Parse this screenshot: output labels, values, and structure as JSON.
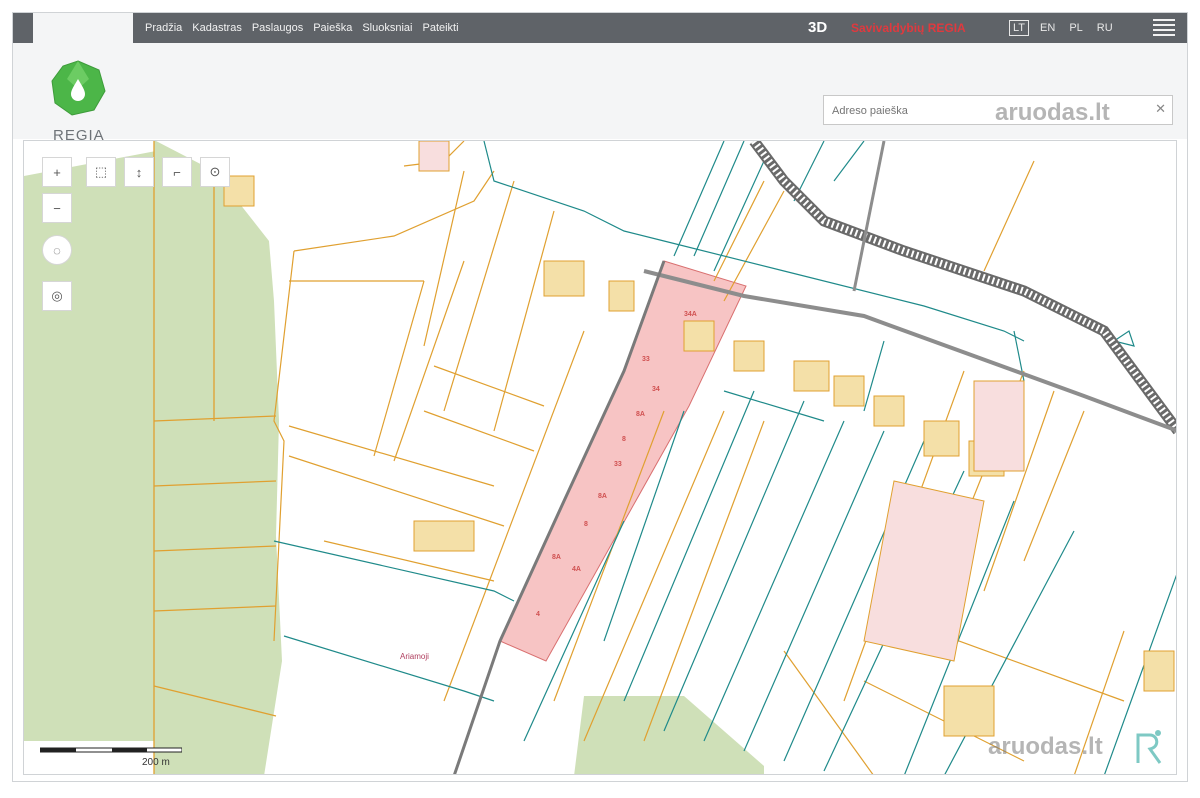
{
  "app": {
    "name": "REGIA",
    "brand": "Savivaldybių REGIA",
    "mode_3d": "3D"
  },
  "menu": {
    "items": [
      {
        "label": "Pradžia"
      },
      {
        "label": "Kadastras"
      },
      {
        "label": "Paslaugos"
      },
      {
        "label": "Paieška"
      },
      {
        "label": "Sluoksniai"
      },
      {
        "label": "Pateikti"
      }
    ]
  },
  "languages": [
    {
      "code": "LT",
      "active": true
    },
    {
      "code": "EN",
      "active": false
    },
    {
      "code": "PL",
      "active": false
    },
    {
      "code": "RU",
      "active": false
    }
  ],
  "search": {
    "placeholder": "Adreso paieška"
  },
  "watermark": {
    "text": "aruodas.lt"
  },
  "map": {
    "scale_label": "200 m",
    "parcel_labels": [
      "34A",
      "33",
      "34",
      "8A",
      "8",
      "33",
      "8A",
      "8",
      "8A",
      "4A",
      "4"
    ],
    "area_label": "Ariamoji",
    "highlight_color": "#f7c4c4",
    "parcel_orange": "#e0a030",
    "parcel_teal": "#1f8a8a",
    "forest_green": "#cfe0b8"
  },
  "tools": [
    {
      "icon": "zoom-in-icon",
      "glyph": "+"
    },
    {
      "icon": "zoom-out-icon",
      "glyph": "−"
    },
    {
      "icon": "full-extent-icon",
      "glyph": "◌"
    },
    {
      "icon": "locate-icon",
      "glyph": "◎"
    },
    {
      "icon": "select-area-icon",
      "glyph": "⬚"
    },
    {
      "icon": "measure-icon",
      "glyph": "↕"
    },
    {
      "icon": "identify-icon",
      "glyph": "⌐"
    },
    {
      "icon": "target-icon",
      "glyph": "⊙"
    }
  ]
}
